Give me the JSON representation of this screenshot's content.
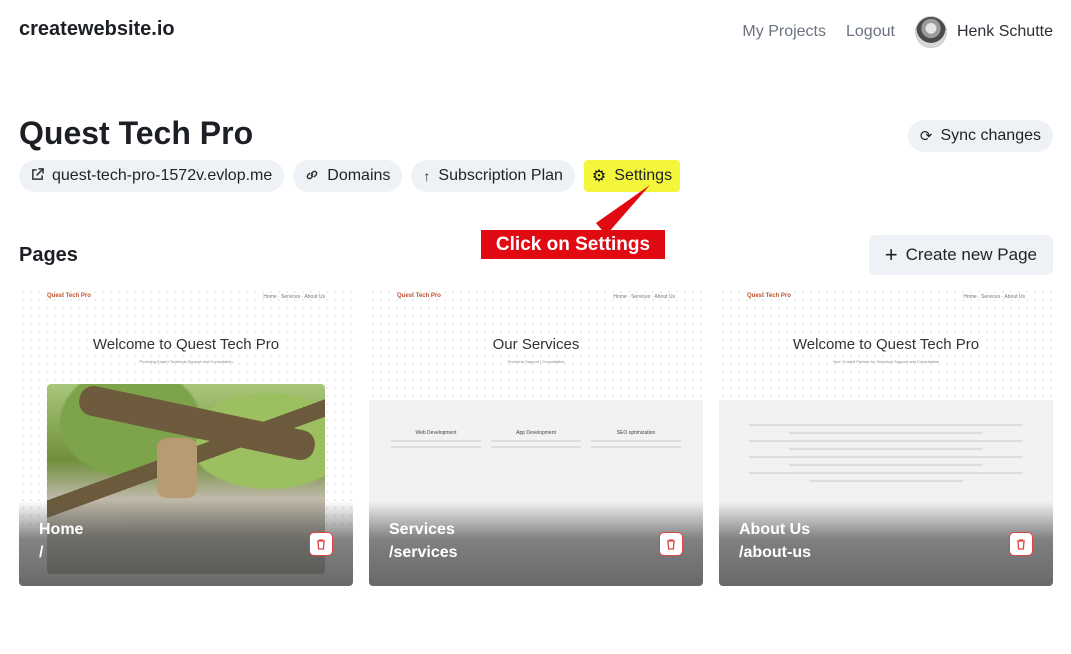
{
  "header": {
    "brand": "createwebsite.io",
    "nav": {
      "projects": "My Projects",
      "logout": "Logout"
    },
    "user": {
      "name": "Henk Schutte"
    }
  },
  "project": {
    "title": "Quest Tech Pro",
    "sync_label": "Sync changes",
    "chips": {
      "domain_link": "quest-tech-pro-1572v.evlop.me",
      "domains": "Domains",
      "subscription": "Subscription Plan",
      "settings": "Settings"
    }
  },
  "annotation": {
    "text": "Click on Settings",
    "color": "#e20a12",
    "highlight": "#f4f63c"
  },
  "pages": {
    "title": "Pages",
    "create_label": "Create new Page",
    "cards": [
      {
        "name": "Home",
        "path": "/",
        "preview_logo": "Quest Tech Pro",
        "preview_nav": "Home · Services · About Us",
        "preview_heading": "Welcome to Quest Tech Pro",
        "preview_sub": "Providing Expert Technical Support and Consultation"
      },
      {
        "name": "Services",
        "path": "/services",
        "preview_logo": "Quest Tech Pro",
        "preview_nav": "Home · Services · About Us",
        "preview_heading": "Our Services",
        "preview_sub": "Technical Support | Consultation",
        "services": [
          "Web Development",
          "App Development",
          "SEO optimization"
        ]
      },
      {
        "name": "About Us",
        "path": "/about-us",
        "preview_logo": "Quest Tech Pro",
        "preview_nav": "Home · Services · About Us",
        "preview_heading": "Welcome to Quest Tech Pro",
        "preview_sub": "Your Trusted Partner for Technical Support and Consultation"
      }
    ]
  },
  "icons": {
    "external": "external-link-icon",
    "link": "link-icon",
    "upload": "arrow-up-icon",
    "gear": "gear-icon",
    "sync": "sync-icon",
    "plus": "plus-icon",
    "trash": "trash-icon"
  }
}
